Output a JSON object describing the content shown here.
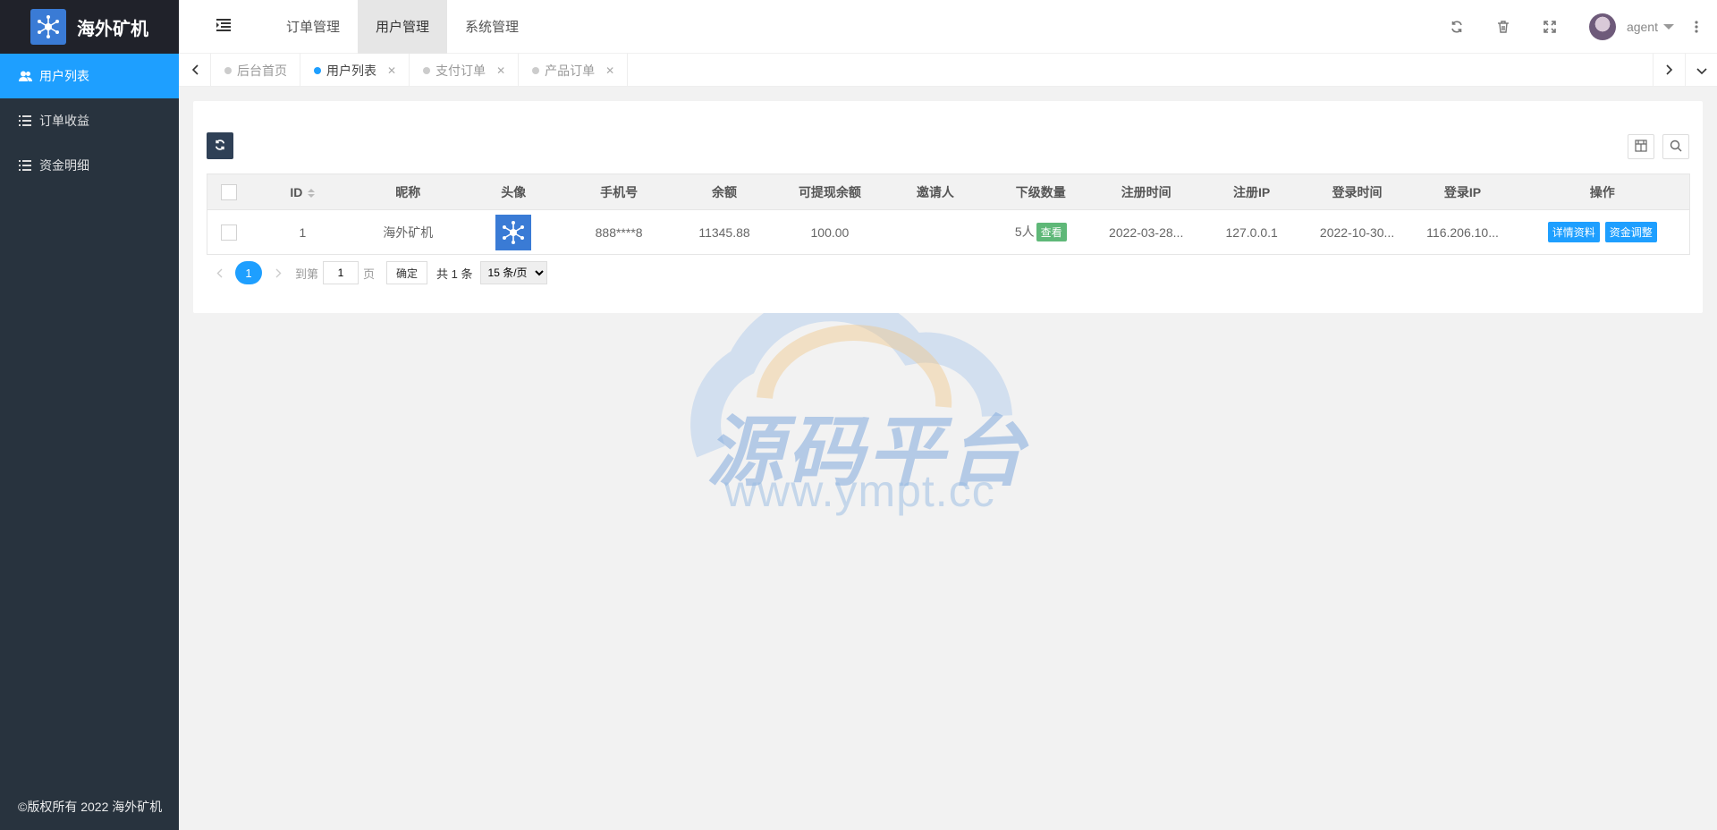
{
  "app": {
    "title": "海外矿机",
    "copyright": "©版权所有 2022 海外矿机"
  },
  "sidebar": {
    "items": [
      {
        "label": "用户列表",
        "icon": "users-icon",
        "active": true
      },
      {
        "label": "订单收益",
        "icon": "list-icon",
        "active": false
      },
      {
        "label": "资金明细",
        "icon": "list-icon",
        "active": false
      }
    ]
  },
  "header": {
    "menu": [
      {
        "label": "订单管理",
        "active": false
      },
      {
        "label": "用户管理",
        "active": true
      },
      {
        "label": "系统管理",
        "active": false
      }
    ],
    "user": "agent"
  },
  "tabs": [
    {
      "label": "后台首页",
      "active": false,
      "closable": false
    },
    {
      "label": "用户列表",
      "active": true,
      "closable": true
    },
    {
      "label": "支付订单",
      "active": false,
      "closable": true
    },
    {
      "label": "产品订单",
      "active": false,
      "closable": true
    }
  ],
  "table": {
    "headers": [
      "ID",
      "昵称",
      "头像",
      "手机号",
      "余额",
      "可提现余额",
      "邀请人",
      "下级数量",
      "注册时间",
      "注册IP",
      "登录时间",
      "登录IP",
      "操作"
    ],
    "rows": [
      {
        "id": "1",
        "nickname": "海外矿机",
        "phone": "888****8",
        "balance": "11345.88",
        "withdrawable": "100.00",
        "inviter": "",
        "sub_count": "5人",
        "sub_view": "查看",
        "reg_time": "2022-03-28...",
        "reg_ip": "127.0.0.1",
        "login_time": "2022-10-30...",
        "login_ip": "116.206.10...",
        "actions": [
          "详情资料",
          "资金调整"
        ]
      }
    ]
  },
  "pager": {
    "current": "1",
    "goto_label": "到第",
    "page_input": "1",
    "page_label": "页",
    "confirm": "确定",
    "total": "共 1 条",
    "per_page": "15 条/页"
  },
  "watermark": {
    "cn": "源码平台",
    "url": "www.ympt.cc"
  },
  "colors": {
    "sidebar": "#28333e",
    "accent": "#1e9fff",
    "green": "#5fb878",
    "logo_bg": "#20222a"
  }
}
